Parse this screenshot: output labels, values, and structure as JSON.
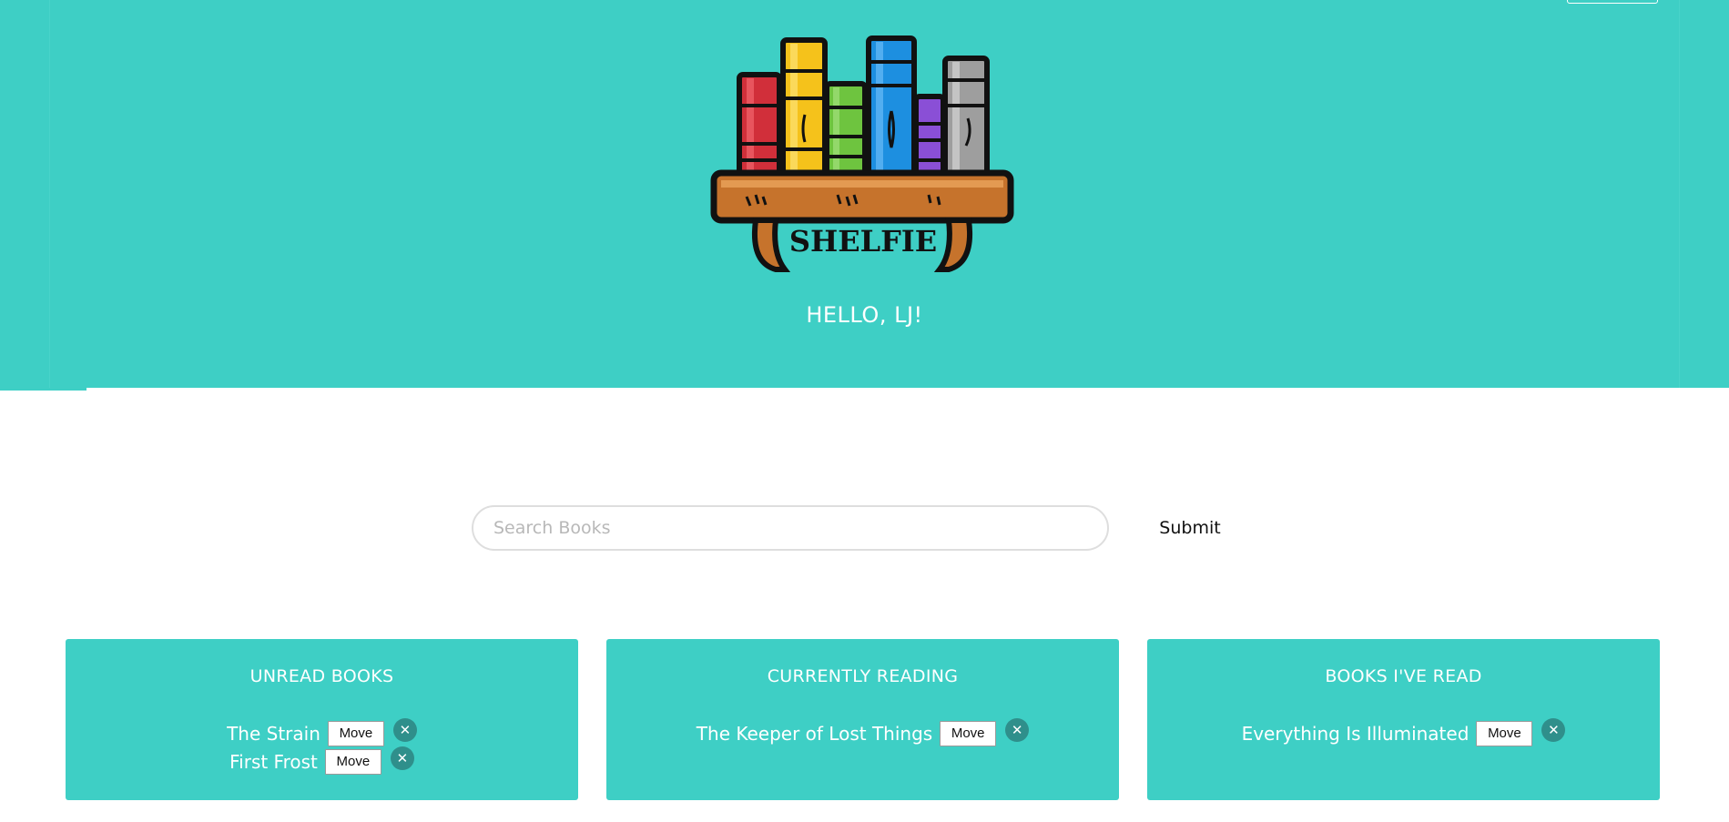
{
  "header": {
    "logo_text": "SHELFIE",
    "greeting": "HELLO, LJ!"
  },
  "search": {
    "placeholder": "Search Books",
    "value": "",
    "submit_label": "Submit"
  },
  "colors": {
    "brand": "#3ecfc5",
    "remove_button": "#2f8f8b",
    "text_on_brand": "#ffffff"
  },
  "shelves": [
    {
      "title": "UNREAD BOOKS",
      "books": [
        {
          "title": "The Strain",
          "move_label": "Move",
          "remove_icon": "close-icon"
        },
        {
          "title": "First Frost",
          "move_label": "Move",
          "remove_icon": "close-icon"
        }
      ]
    },
    {
      "title": "CURRENTLY READING",
      "books": [
        {
          "title": "The Keeper of Lost Things",
          "move_label": "Move",
          "remove_icon": "close-icon"
        }
      ]
    },
    {
      "title": "BOOKS I'VE READ",
      "books": [
        {
          "title": "Everything Is Illuminated",
          "move_label": "Move",
          "remove_icon": "close-icon"
        }
      ]
    }
  ]
}
